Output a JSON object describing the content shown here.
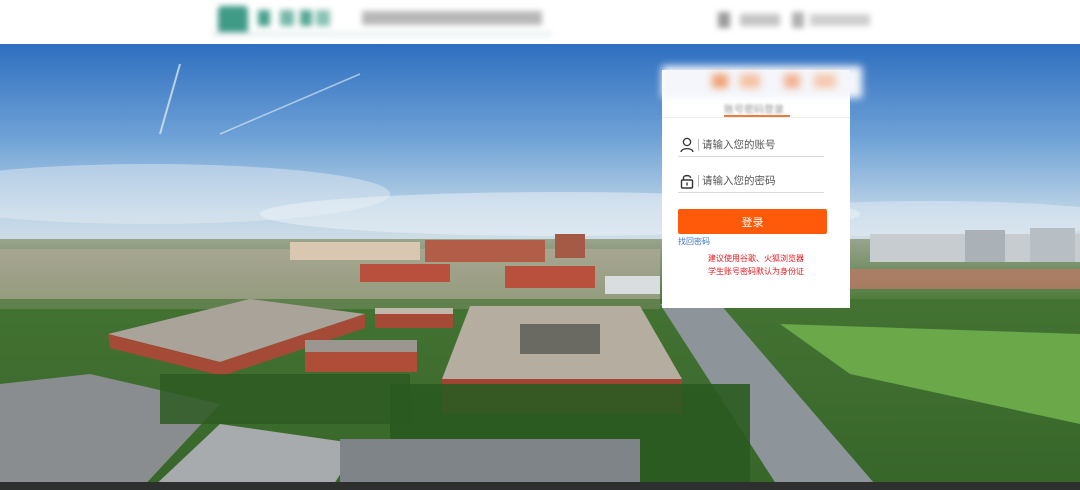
{
  "login": {
    "tab_label": "账号密码登录",
    "username_placeholder": "请输入您的账号",
    "password_placeholder": "请输入您的密码",
    "login_button": "登录",
    "forgot_password": "找回密码",
    "tip_browser": "建议使用谷歌、火狐浏览器",
    "tip_account": "学生账号密码默认为身份证"
  },
  "icons": {
    "username": "user-icon",
    "password": "lock-icon"
  },
  "colors": {
    "accent": "#ff5a0a",
    "tab_underline": "#f07a3a",
    "link": "#3a73c9",
    "tip": "#e4161b",
    "header_logo": "#3f9a86"
  }
}
